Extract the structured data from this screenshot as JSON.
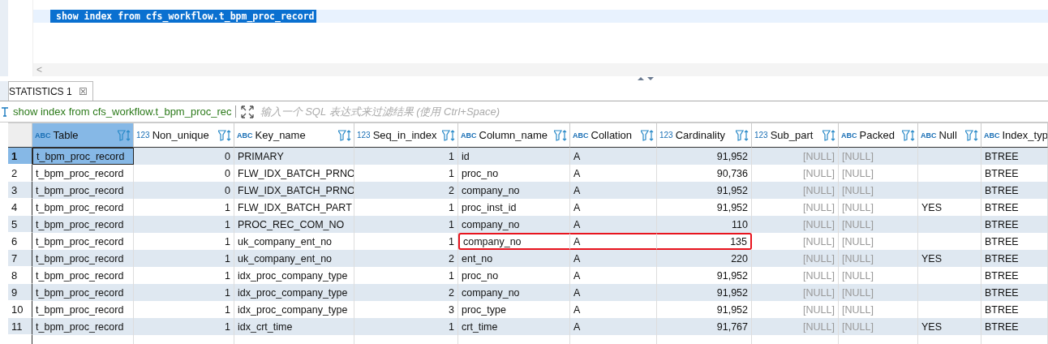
{
  "editor": {
    "sql": "show index from cfs_workflow.t_bpm_proc_record",
    "selected": true,
    "scroll_left": "<"
  },
  "result_tab": {
    "label": "STATISTICS 1",
    "close": "☒",
    "selected": true
  },
  "filter_bar": {
    "query": "show index from cfs_workflow.t_bpm_proc_rec",
    "placeholder": "输入一个 SQL 表达式来过滤结果 (使用 Ctrl+Space)"
  },
  "table": {
    "columns": [
      {
        "name": "Table",
        "type": "ABC",
        "muted": false,
        "selected": true
      },
      {
        "name": "Non_unique",
        "type": "123",
        "muted": false,
        "selected": false
      },
      {
        "name": "Key_name",
        "type": "ABC",
        "muted": false,
        "selected": false
      },
      {
        "name": "Seq_in_index",
        "type": "123",
        "muted": false,
        "selected": false
      },
      {
        "name": "Column_name",
        "type": "ABC",
        "muted": false,
        "selected": false
      },
      {
        "name": "Collation",
        "type": "ABC",
        "muted": false,
        "selected": false
      },
      {
        "name": "Cardinality",
        "type": "123",
        "muted": false,
        "selected": false
      },
      {
        "name": "Sub_part",
        "type": "123",
        "muted": true,
        "selected": false
      },
      {
        "name": "Packed",
        "type": "ABC",
        "muted": true,
        "selected": false
      },
      {
        "name": "Null",
        "type": "ABC",
        "muted": false,
        "selected": false
      },
      {
        "name": "Index_typ",
        "type": "ABC",
        "muted": false,
        "selected": false
      }
    ],
    "rows": [
      {
        "num": "1",
        "selected": true,
        "highlighted": false,
        "cells": [
          "t_bpm_proc_record",
          "0",
          "PRIMARY",
          "1",
          "id",
          "A",
          "91,952",
          "[NULL]",
          "[NULL]",
          null,
          "BTREE"
        ]
      },
      {
        "num": "2",
        "selected": false,
        "highlighted": false,
        "cells": [
          "t_bpm_proc_record",
          "0",
          "FLW_IDX_BATCH_PRNO",
          "1",
          "proc_no",
          "A",
          "90,736",
          "[NULL]",
          "[NULL]",
          null,
          "BTREE"
        ]
      },
      {
        "num": "3",
        "selected": false,
        "highlighted": false,
        "cells": [
          "t_bpm_proc_record",
          "0",
          "FLW_IDX_BATCH_PRNO",
          "2",
          "company_no",
          "A",
          "91,952",
          "[NULL]",
          "[NULL]",
          null,
          "BTREE"
        ]
      },
      {
        "num": "4",
        "selected": false,
        "highlighted": false,
        "cells": [
          "t_bpm_proc_record",
          "1",
          "FLW_IDX_BATCH_PART",
          "1",
          "proc_inst_id",
          "A",
          "91,952",
          "[NULL]",
          "[NULL]",
          "YES",
          "BTREE"
        ]
      },
      {
        "num": "5",
        "selected": false,
        "highlighted": false,
        "cells": [
          "t_bpm_proc_record",
          "1",
          "PROC_REC_COM_NO",
          "1",
          "company_no",
          "A",
          "110",
          "[NULL]",
          "[NULL]",
          null,
          "BTREE"
        ]
      },
      {
        "num": "6",
        "selected": false,
        "highlighted": true,
        "cells": [
          "t_bpm_proc_record",
          "1",
          "uk_company_ent_no",
          "1",
          "company_no",
          "A",
          "135",
          "[NULL]",
          "[NULL]",
          null,
          "BTREE"
        ]
      },
      {
        "num": "7",
        "selected": false,
        "highlighted": false,
        "cells": [
          "t_bpm_proc_record",
          "1",
          "uk_company_ent_no",
          "2",
          "ent_no",
          "A",
          "220",
          "[NULL]",
          "[NULL]",
          "YES",
          "BTREE"
        ]
      },
      {
        "num": "8",
        "selected": false,
        "highlighted": false,
        "cells": [
          "t_bpm_proc_record",
          "1",
          "idx_proc_company_type",
          "1",
          "proc_no",
          "A",
          "91,952",
          "[NULL]",
          "[NULL]",
          null,
          "BTREE"
        ]
      },
      {
        "num": "9",
        "selected": false,
        "highlighted": false,
        "cells": [
          "t_bpm_proc_record",
          "1",
          "idx_proc_company_type",
          "2",
          "company_no",
          "A",
          "91,952",
          "[NULL]",
          "[NULL]",
          null,
          "BTREE"
        ]
      },
      {
        "num": "10",
        "selected": false,
        "highlighted": false,
        "cells": [
          "t_bpm_proc_record",
          "1",
          "idx_proc_company_type",
          "3",
          "proc_type",
          "A",
          "91,952",
          "[NULL]",
          "[NULL]",
          null,
          "BTREE"
        ]
      },
      {
        "num": "11",
        "selected": false,
        "highlighted": false,
        "cells": [
          "t_bpm_proc_record",
          "1",
          "idx_crt_time",
          "1",
          "crt_time",
          "A",
          "91,767",
          "[NULL]",
          "[NULL]",
          "YES",
          "BTREE"
        ]
      }
    ]
  }
}
